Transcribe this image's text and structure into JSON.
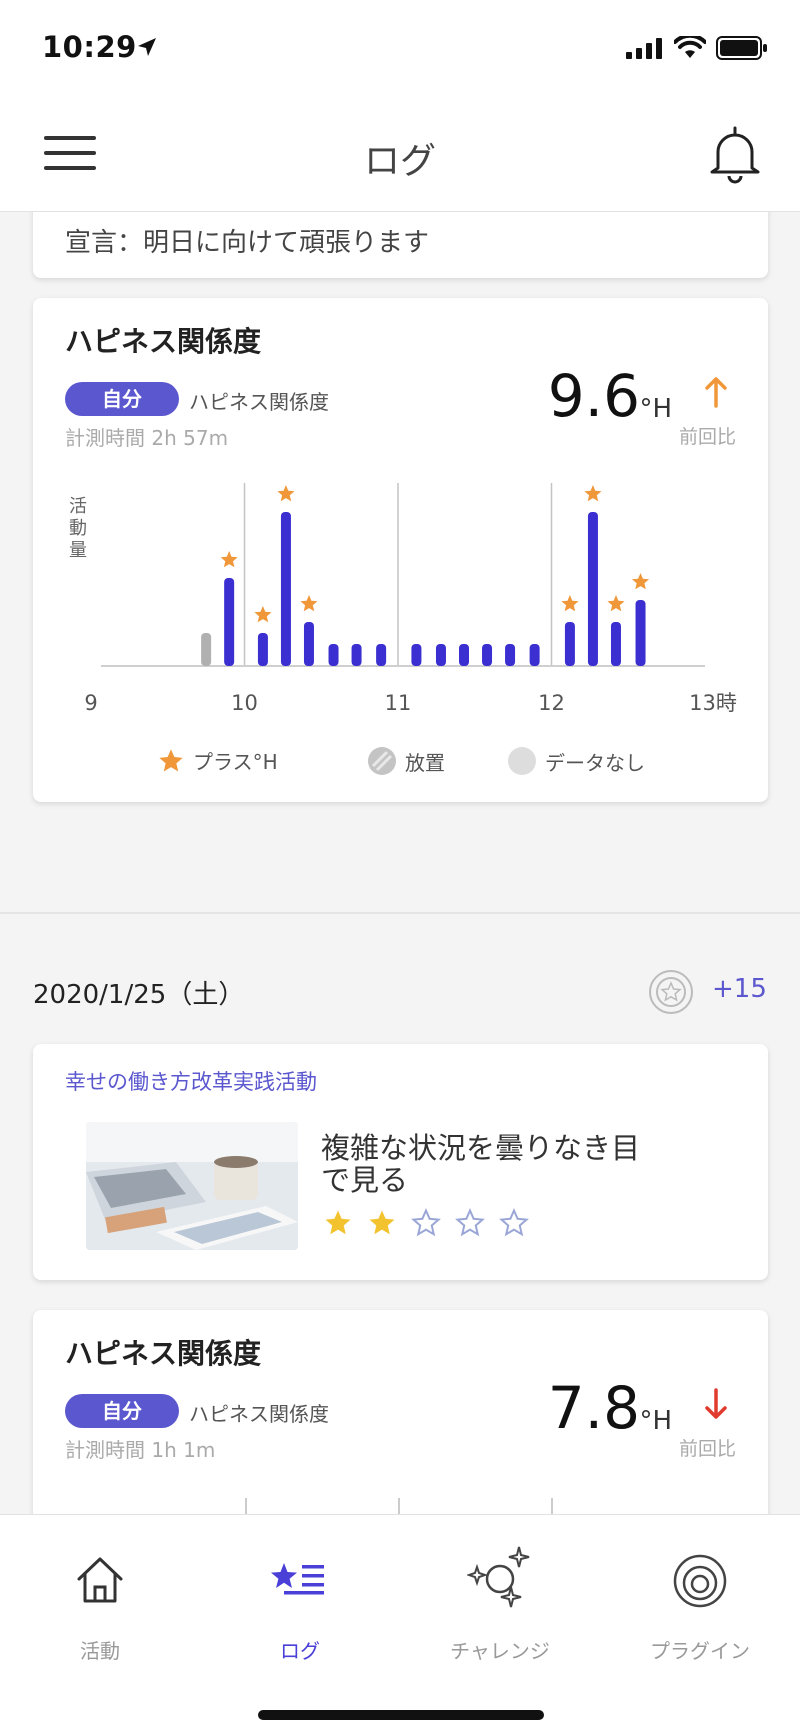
{
  "status": {
    "time": "10:29"
  },
  "nav": {
    "title": "ログ"
  },
  "declaration": {
    "text": "宣言：明日に向けて頑張ります"
  },
  "happiness1": {
    "title": "ハピネス関係度",
    "badge": "自分",
    "subtitle": "ハピネス関係度",
    "measure": "計測時間 2h 57m",
    "score": "9.6",
    "unit": "°H",
    "trend": "up",
    "prev_label": "前回比"
  },
  "chart_data": {
    "type": "bar",
    "ylabel": "活動量",
    "x_ticks": [
      "9",
      "10",
      "11",
      "12",
      "13時"
    ],
    "x": [
      9.75,
      9.9,
      10.12,
      10.27,
      10.42,
      10.58,
      10.73,
      10.89,
      11.12,
      11.28,
      11.43,
      11.58,
      11.73,
      11.89,
      12.12,
      12.27,
      12.42,
      12.58
    ],
    "values": [
      1.5,
      4,
      1.5,
      7,
      2,
      1,
      1,
      1,
      1,
      1,
      1,
      1,
      1,
      1,
      2,
      7,
      2,
      3
    ],
    "status": [
      "idle",
      "active",
      "active",
      "active",
      "active",
      "active",
      "active",
      "active",
      "active",
      "active",
      "active",
      "active",
      "active",
      "active",
      "active",
      "active",
      "active",
      "active"
    ],
    "plus_h": [
      false,
      true,
      true,
      true,
      true,
      false,
      false,
      false,
      false,
      false,
      false,
      false,
      false,
      false,
      true,
      true,
      true,
      true
    ],
    "xlim": [
      9,
      13
    ],
    "legend": [
      "プラス°H",
      "放置",
      "データなし"
    ],
    "colors": {
      "active": "#3b2fd1",
      "idle": "#b0b0b0",
      "star": "#f0973a"
    }
  },
  "day": {
    "date": "2020/1/25（土）",
    "plus": "+15"
  },
  "challenge": {
    "category": "幸せの働き方改革実践活動",
    "title": "複雑な状況を曇りなき目で見る",
    "rating": 2,
    "max_rating": 5
  },
  "happiness2": {
    "title": "ハピネス関係度",
    "badge": "自分",
    "subtitle": "ハピネス関係度",
    "measure": "計測時間 1h 1m",
    "score": "7.8",
    "unit": "°H",
    "trend": "down",
    "prev_label": "前回比"
  },
  "tabs": [
    {
      "label": "活動",
      "icon": "home-icon",
      "active": false
    },
    {
      "label": "ログ",
      "icon": "star-list-icon",
      "active": true
    },
    {
      "label": "チャレンジ",
      "icon": "sparkle-planet-icon",
      "active": false
    },
    {
      "label": "プラグイン",
      "icon": "target-icon",
      "active": false
    }
  ],
  "theme": {
    "accent": "#5b57cf",
    "up": "#f0973a",
    "down": "#e03b2f"
  }
}
